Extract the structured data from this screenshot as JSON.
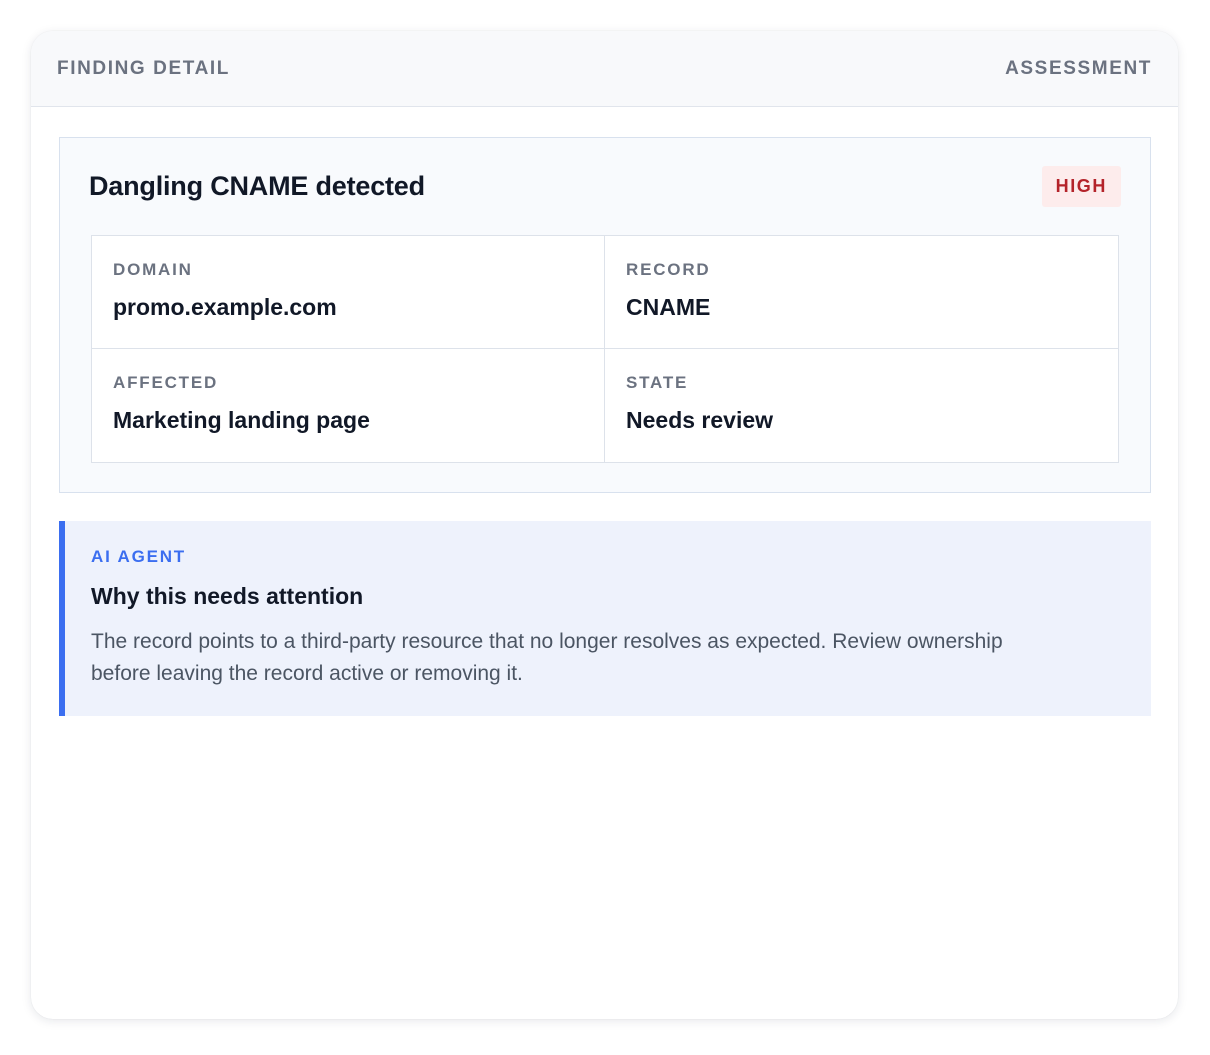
{
  "header": {
    "left_label": "FINDING DETAIL",
    "right_label": "ASSESSMENT"
  },
  "finding": {
    "title": "Dangling CNAME detected",
    "severity": "HIGH",
    "fields": [
      {
        "label": "DOMAIN",
        "value": "promo.example.com"
      },
      {
        "label": "RECORD",
        "value": "CNAME"
      },
      {
        "label": "AFFECTED",
        "value": "Marketing landing page"
      },
      {
        "label": "STATE",
        "value": "Needs review"
      }
    ]
  },
  "ai_agent": {
    "tag": "AI AGENT",
    "heading": "Why this needs attention",
    "body": "The record points to a third-party resource that no longer resolves as expected. Review ownership before leaving the record active or removing it."
  },
  "colors": {
    "accent": "#3b6ef0",
    "severity_high_text": "#b4232a",
    "severity_high_bg": "#fdecec",
    "ai_block_bg": "#eef2fc"
  }
}
